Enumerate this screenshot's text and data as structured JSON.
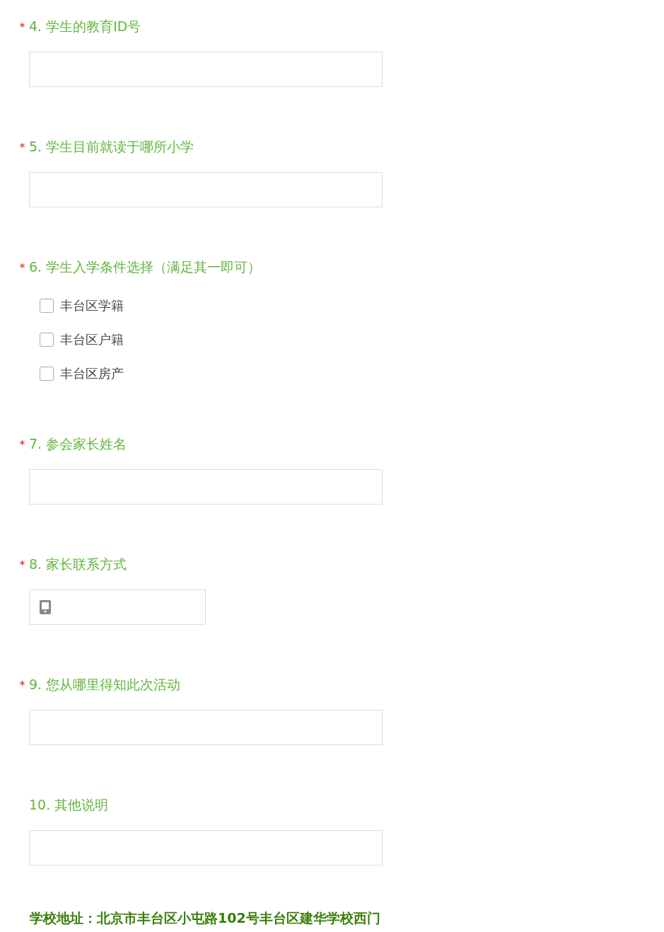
{
  "questions": [
    {
      "number": "4.",
      "title": "学生的教育ID号",
      "required": true,
      "kind": "text"
    },
    {
      "number": "5.",
      "title": "学生目前就读于哪所小学",
      "required": true,
      "kind": "text"
    },
    {
      "number": "6.",
      "title": "学生入学条件选择（满足其一即可）",
      "required": true,
      "kind": "checkbox",
      "options": [
        {
          "label": "丰台区学籍",
          "checked": false
        },
        {
          "label": "丰台区户籍",
          "checked": false
        },
        {
          "label": "丰台区房产",
          "checked": false
        }
      ]
    },
    {
      "number": "7.",
      "title": "参会家长姓名",
      "required": true,
      "kind": "text"
    },
    {
      "number": "8.",
      "title": "家长联系方式",
      "required": true,
      "kind": "phone"
    },
    {
      "number": "9.",
      "title": "您从哪里得知此次活动",
      "required": true,
      "kind": "text"
    },
    {
      "number": "10.",
      "title": "其他说明",
      "required": false,
      "kind": "text"
    }
  ],
  "address": "学校地址：北京市丰台区小屯路102号丰台区建华学校西门"
}
